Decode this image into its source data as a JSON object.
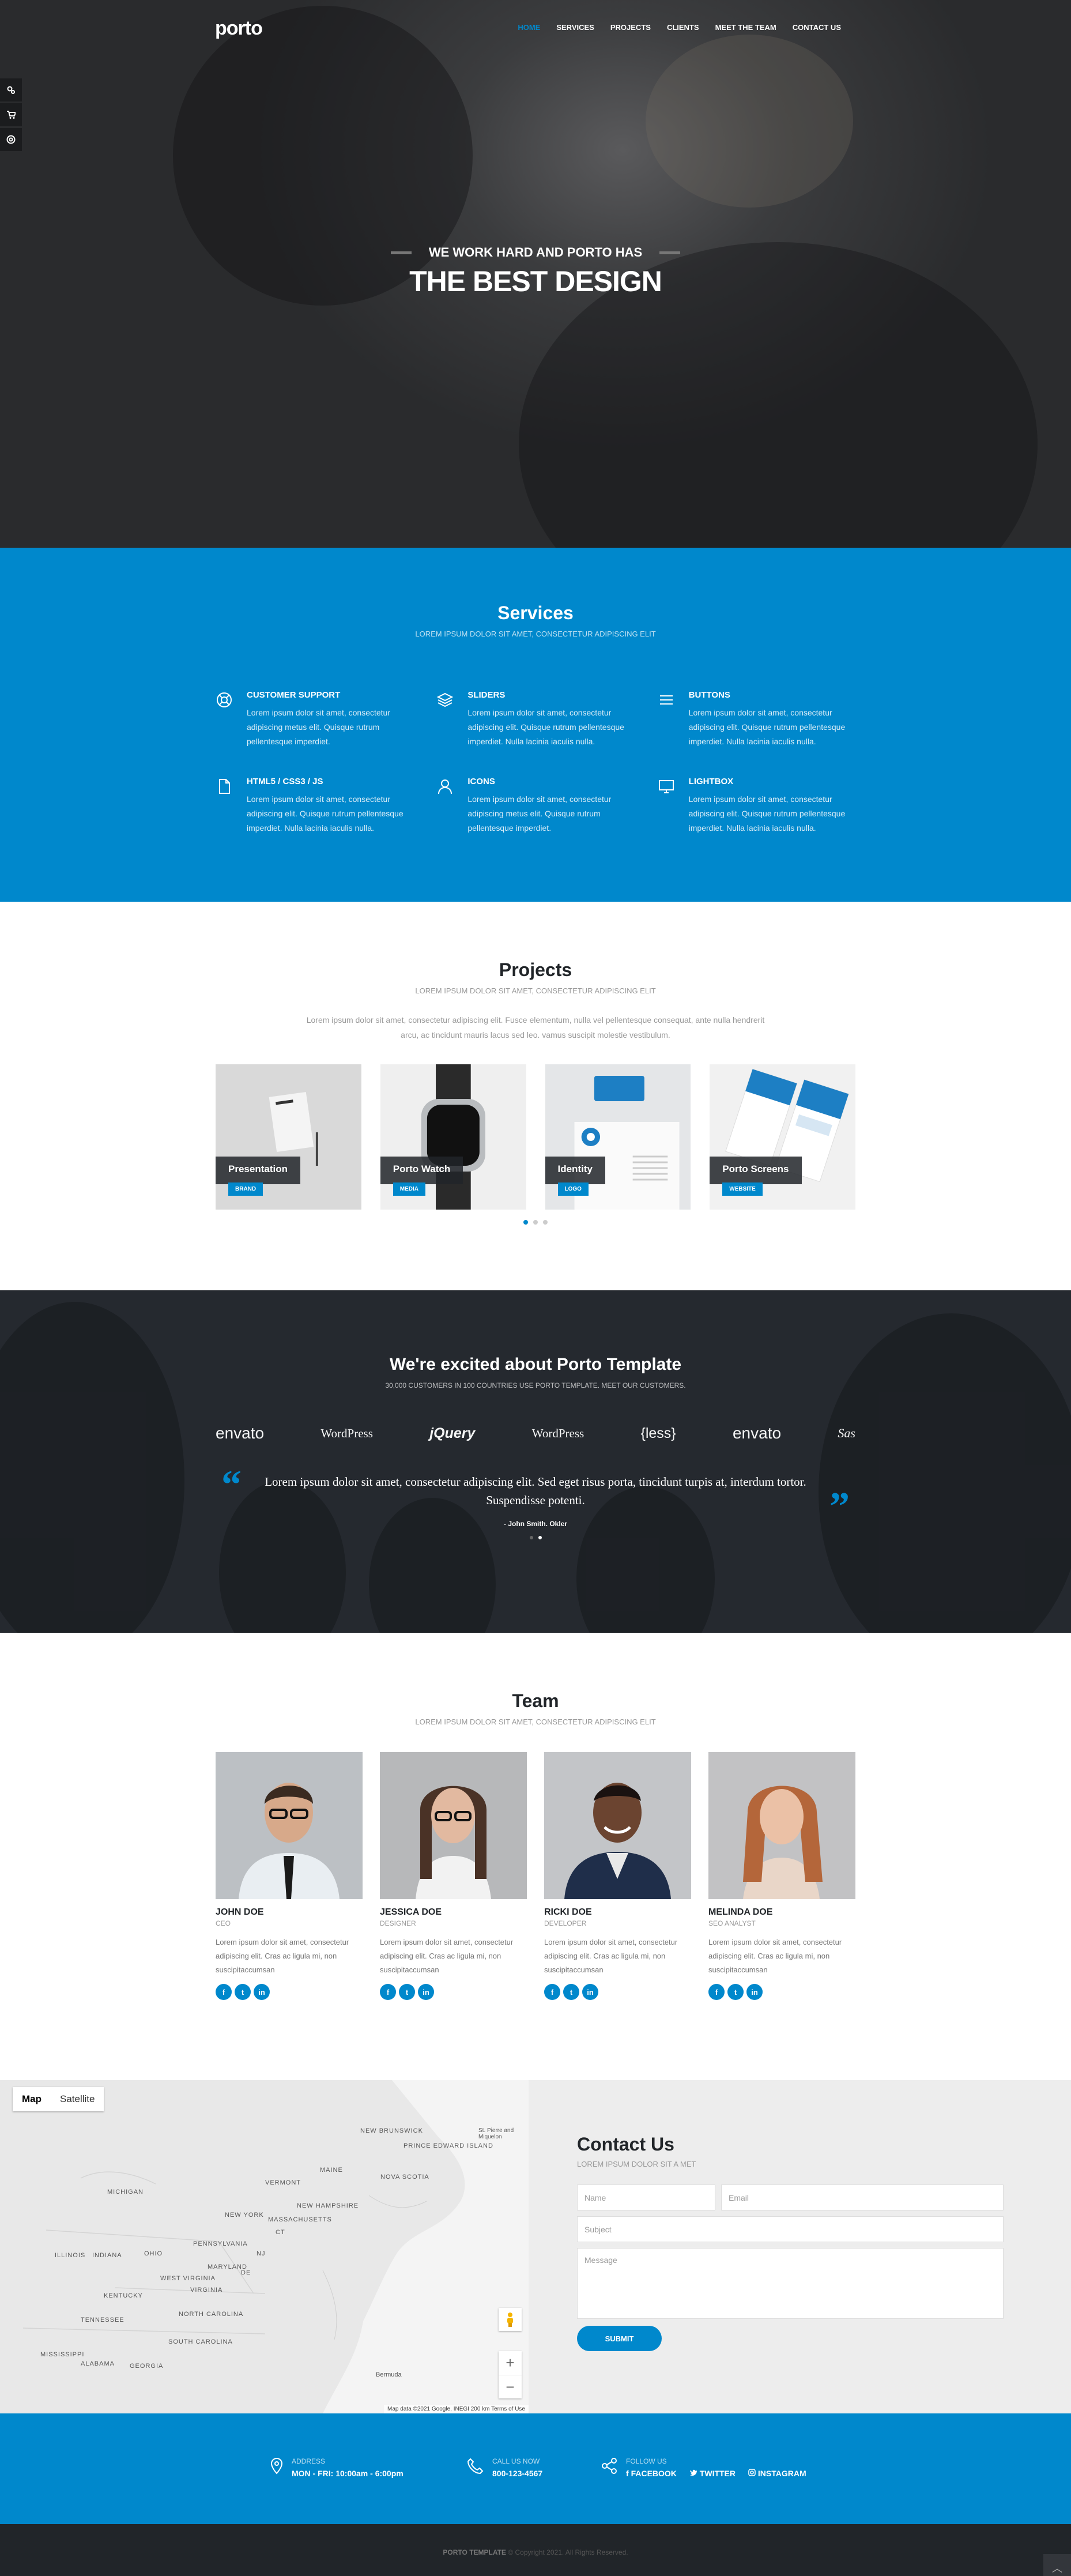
{
  "header": {
    "logo": "porto",
    "nav": [
      "HOME",
      "SERVICES",
      "PROJECTS",
      "CLIENTS",
      "MEET THE TEAM",
      "CONTACT US"
    ]
  },
  "hero": {
    "subtitle": "WE WORK HARD AND PORTO HAS",
    "title": "THE BEST DESIGN"
  },
  "services": {
    "title": "Services",
    "subtitle": "LOREM IPSUM DOLOR SIT AMET, CONSECTETUR ADIPISCING ELIT",
    "items": [
      {
        "title": "CUSTOMER SUPPORT",
        "text": "Lorem ipsum dolor sit amet, consectetur adipiscing metus elit. Quisque rutrum pellentesque imperdiet.",
        "icon": "lifebuoy-icon"
      },
      {
        "title": "SLIDERS",
        "text": "Lorem ipsum dolor sit amet, consectetur adipiscing elit. Quisque rutrum pellentesque imperdiet. Nulla lacinia iaculis nulla.",
        "icon": "layers-icon"
      },
      {
        "title": "BUTTONS",
        "text": "Lorem ipsum dolor sit amet, consectetur adipiscing elit. Quisque rutrum pellentesque imperdiet. Nulla lacinia iaculis nulla.",
        "icon": "menu-icon"
      },
      {
        "title": "HTML5 / CSS3 / JS",
        "text": "Lorem ipsum dolor sit amet, consectetur adipiscing elit. Quisque rutrum pellentesque imperdiet. Nulla lacinia iaculis nulla.",
        "icon": "file-icon"
      },
      {
        "title": "ICONS",
        "text": "Lorem ipsum dolor sit amet, consectetur adipiscing metus elit. Quisque rutrum pellentesque imperdiet.",
        "icon": "user-icon"
      },
      {
        "title": "LIGHTBOX",
        "text": "Lorem ipsum dolor sit amet, consectetur adipiscing elit. Quisque rutrum pellentesque imperdiet. Nulla lacinia iaculis nulla.",
        "icon": "monitor-icon"
      }
    ]
  },
  "projects": {
    "title": "Projects",
    "subtitle": "LOREM IPSUM DOLOR SIT AMET, CONSECTETUR ADIPISCING ELIT",
    "intro": "Lorem ipsum dolor sit amet, consectetur adipiscing elit. Fusce elementum, nulla vel pellentesque consequat, ante nulla hendrerit arcu, ac tincidunt mauris lacus sed leo. vamus suscipit molestie vestibulum.",
    "items": [
      {
        "name": "Presentation",
        "tag": "BRAND"
      },
      {
        "name": "Porto Watch",
        "tag": "MEDIA"
      },
      {
        "name": "Identity",
        "tag": "LOGO"
      },
      {
        "name": "Porto Screens",
        "tag": "WEBSITE"
      }
    ]
  },
  "testimonials": {
    "title": "We're excited about Porto Template",
    "subtitle": "30,000 CUSTOMERS IN 100 COUNTRIES USE PORTO TEMPLATE. MEET OUR CUSTOMERS.",
    "brands": [
      "envato",
      "WordPress",
      "jQuery",
      "WordPress",
      "{less}",
      "envato",
      "Sas"
    ],
    "quote": "Lorem ipsum dolor sit amet, consectetur adipiscing elit. Sed eget risus porta, tincidunt turpis at, interdum tortor. Suspendisse potenti.",
    "author": "- John Smith. Okler"
  },
  "team": {
    "title": "Team",
    "subtitle": "LOREM IPSUM DOLOR SIT AMET, CONSECTETUR ADIPISCING ELIT",
    "members": [
      {
        "name": "JOHN DOE",
        "role": "CEO",
        "bio": "Lorem ipsum dolor sit amet, consectetur adipiscing elit. Cras ac ligula mi, non suscipitaccumsan"
      },
      {
        "name": "JESSICA DOE",
        "role": "DESIGNER",
        "bio": "Lorem ipsum dolor sit amet, consectetur adipiscing elit. Cras ac ligula mi, non suscipitaccumsan"
      },
      {
        "name": "RICKI DOE",
        "role": "DEVELOPER",
        "bio": "Lorem ipsum dolor sit amet, consectetur adipiscing elit. Cras ac ligula mi, non suscipitaccumsan"
      },
      {
        "name": "MELINDA DOE",
        "role": "SEO ANALYST",
        "bio": "Lorem ipsum dolor sit amet, consectetur adipiscing elit. Cras ac ligula mi, non suscipitaccumsan"
      }
    ],
    "social": [
      "f",
      "t",
      "in"
    ]
  },
  "map": {
    "tabs": [
      "Map",
      "Satellite"
    ],
    "labels": [
      "NEW BRUNSWICK",
      "PRINCE EDWARD ISLAND",
      "MAINE",
      "NOVA SCOTIA",
      "VERMONT",
      "NEW HAMPSHIRE",
      "MICHIGAN",
      "NEW YORK",
      "MASSACHUSETTS",
      "CT",
      "ILLINOIS",
      "INDIANA",
      "OHIO",
      "PENNSYLVANIA",
      "NJ",
      "MARYLAND",
      "DE",
      "WEST VIRGINIA",
      "VIRGINIA",
      "KENTUCKY",
      "TENNESSEE",
      "NORTH CAROLINA",
      "SOUTH CAROLINA",
      "MISSISSIPPI",
      "ALABAMA",
      "GEORGIA",
      "Bermuda",
      "St. Pierre and Miquelon"
    ],
    "attribution": "Map data ©2021 Google, INEGI   200 km   Terms of Use"
  },
  "contact": {
    "title": "Contact Us",
    "subtitle": "LOREM IPSUM DOLOR SIT A MET",
    "name_ph": "Name",
    "email_ph": "Email",
    "subject_ph": "Subject",
    "message_ph": "Message",
    "submit": "SUBMIT"
  },
  "info": {
    "address_label": "ADDRESS",
    "address_value": "MON - FRI: 10:00am - 6:00pm",
    "call_label": "CALL US NOW",
    "call_value": "800-123-4567",
    "follow_label": "FOLLOW US",
    "follow_links": [
      "FACEBOOK",
      "TWITTER",
      "INSTAGRAM"
    ]
  },
  "footer": {
    "brand": "PORTO TEMPLATE",
    "copyright": "© Copyright 2021. All Rights Reserved."
  },
  "colors": {
    "accent": "#0088cc",
    "dark": "#212529"
  }
}
